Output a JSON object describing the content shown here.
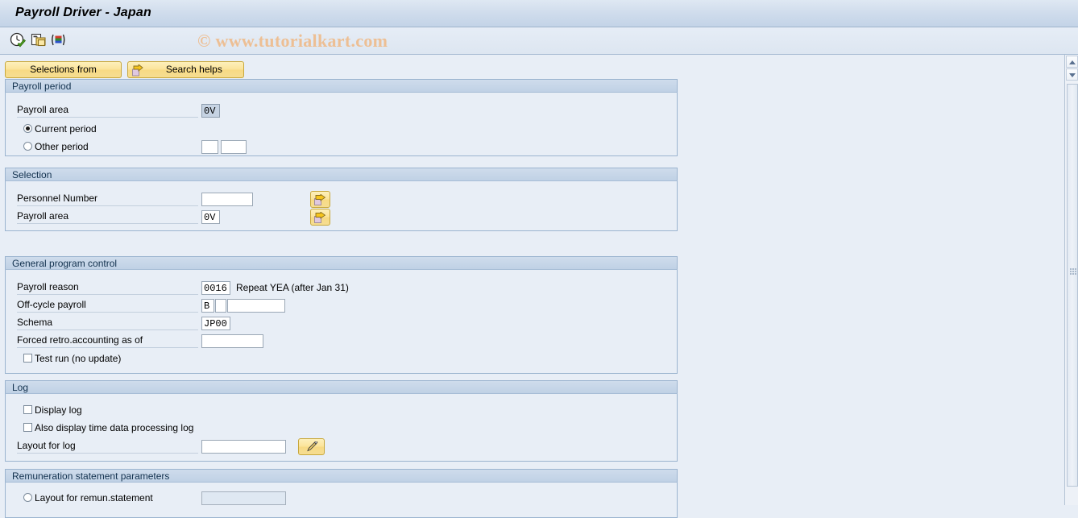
{
  "window": {
    "title": "Payroll Driver - Japan"
  },
  "watermark": {
    "text": "© www.tutorialkart.com",
    "color": "#edbf94"
  },
  "toolbar": {
    "icons": [
      {
        "name": "execute-icon",
        "tooltip": "Execute"
      },
      {
        "name": "copy-icon",
        "tooltip": "Get Variant"
      },
      {
        "name": "variant-icon",
        "tooltip": "Display Variant"
      }
    ]
  },
  "buttons": {
    "selections_from": "Selections from",
    "search_helps": "Search helps"
  },
  "sections": {
    "payroll_period": {
      "title": "Payroll period",
      "payroll_area_label": "Payroll area",
      "payroll_area_value": "0V",
      "current_period_label": "Current period",
      "current_period_selected": true,
      "other_period_label": "Other period",
      "other_period_selected": false,
      "other_period_value_1": "",
      "other_period_value_2": ""
    },
    "selection": {
      "title": "Selection",
      "personnel_number_label": "Personnel Number",
      "personnel_number_value": "",
      "payroll_area_label": "Payroll area",
      "payroll_area_value": "0V",
      "multi_select_icon": "multiple-selection-arrow-icon"
    },
    "general_program_control": {
      "title": "General program control",
      "payroll_reason_label": "Payroll reason",
      "payroll_reason_value": "0016",
      "payroll_reason_text": "Repeat YEA (after Jan 31)",
      "off_cycle_payroll_label": "Off-cycle payroll",
      "off_cycle_value_1": "B",
      "off_cycle_value_2": "",
      "off_cycle_value_3": "",
      "schema_label": "Schema",
      "schema_value": "JP00",
      "forced_retro_label": "Forced retro.accounting as of",
      "forced_retro_value": "",
      "test_run_label": "Test run (no update)",
      "test_run_checked": false
    },
    "log": {
      "title": "Log",
      "display_log_label": "Display log",
      "display_log_checked": false,
      "also_display_time_label": "Also display time data processing log",
      "also_display_time_checked": false,
      "layout_for_log_label": "Layout for log",
      "layout_for_log_value": "",
      "layout_edit_icon": "pencil-edit-icon"
    },
    "remuneration": {
      "title": "Remuneration statement parameters",
      "layout_remun_label": "Layout for remun.statement",
      "layout_remun_selected": false,
      "layout_remun_value": ""
    }
  },
  "scrollbar": {
    "up_arrow": "scroll-up-arrow",
    "down_arrow": "scroll-down-arrow"
  }
}
